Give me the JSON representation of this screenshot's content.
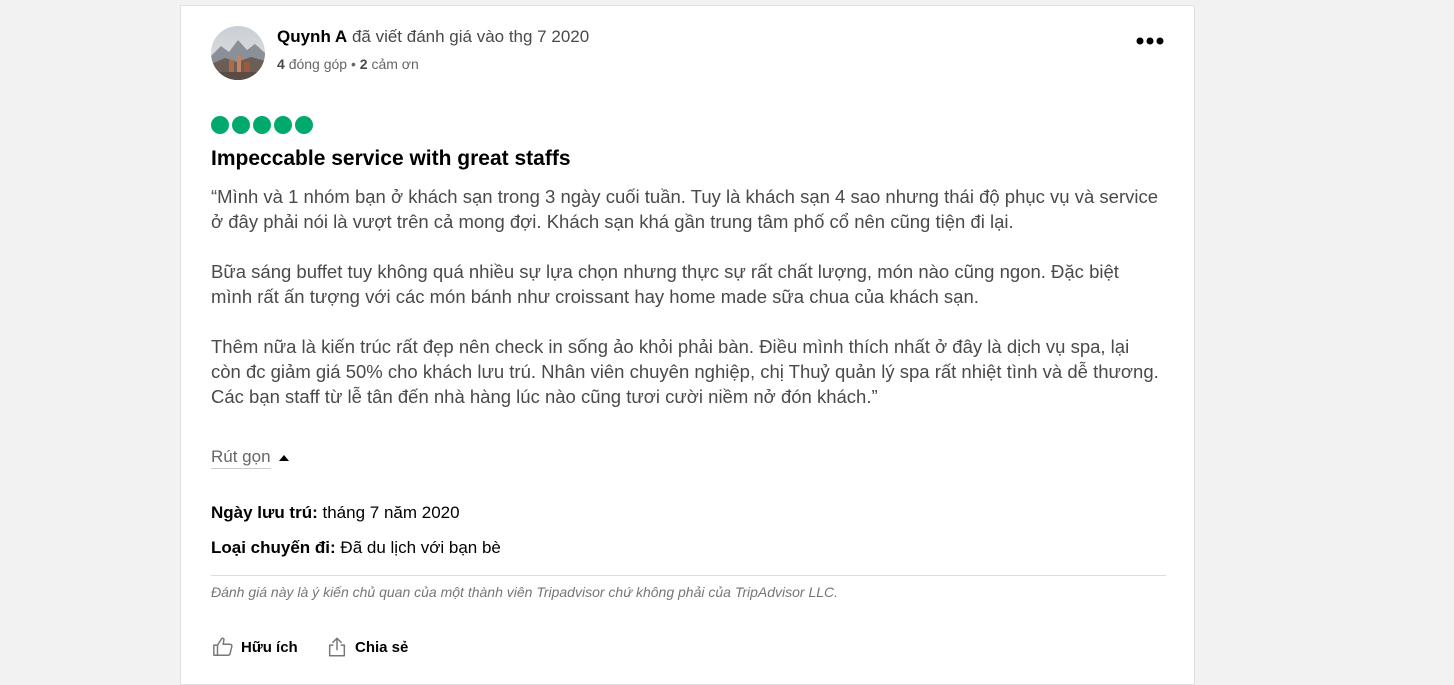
{
  "review": {
    "author": "Quynh A",
    "action_text": "đã viết đánh giá vào thg 7 2020",
    "contributions_count": "4",
    "contributions_label": "đóng góp",
    "separator": "•",
    "thanks_count": "2",
    "thanks_label": "cảm ơn",
    "rating": 5,
    "rating_color": "#00aa6c",
    "title": "Impeccable service with great staffs",
    "paragraphs": [
      "“Mình và 1 nhóm bạn ở khách sạn trong 3 ngày cuối tuần. Tuy là khách sạn 4 sao nhưng thái độ phục vụ và service ở đây phải nói là vượt trên cả mong đợi. Khách sạn khá gần trung tâm phố cổ nên cũng tiện đi lại.",
      "Bữa sáng buffet tuy không quá nhiều sự lựa chọn nhưng thực sự rất chất lượng, món nào cũng ngon. Đặc biệt mình rất ấn tượng với các món bánh như croissant hay home made sữa chua của khách sạn.",
      "Thêm nữa là kiến trúc rất đẹp nên check in sống ảo khỏi phải bàn. Điều mình thích nhất ở đây là dịch vụ spa, lại còn đc giảm giá 50% cho khách lưu trú. Nhân viên chuyên nghiệp, chị Thuỷ quản lý spa rất nhiệt tình và dễ thương. Các bạn staff từ lễ tân đến nhà hàng lúc nào cũng tươi cười niềm nở đón khách.”"
    ],
    "collapse_label": "Rút gọn",
    "stay_date_label": "Ngày lưu trú:",
    "stay_date_value": "tháng 7 năm 2020",
    "trip_type_label": "Loại chuyến đi:",
    "trip_type_value": "Đã du lịch với bạn bè",
    "disclaimer": "Đánh giá này là ý kiến chủ quan của một thành viên Tripadvisor chứ không phải của TripAdvisor LLC.",
    "helpful_label": "Hữu ích",
    "share_label": "Chia sẻ"
  },
  "icons": {
    "more": "more-horizontal-icon",
    "collapse": "caret-up-icon",
    "helpful": "thumbs-up-icon",
    "share": "share-icon"
  }
}
